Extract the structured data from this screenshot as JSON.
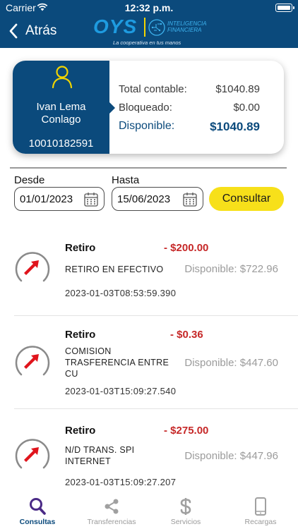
{
  "status_bar": {
    "carrier": "Carrier",
    "time": "12:32 p.m."
  },
  "header": {
    "back_label": "Atrás",
    "logo": {
      "brand": "OYS",
      "line1": "INTELIGENCIA",
      "line2": "FINANCIERA",
      "tagline": "La cooperativa en tus manos"
    }
  },
  "account": {
    "owner": "Ivan Lema Conlago",
    "number": "10010182591",
    "total_label": "Total contable:",
    "total_value": "$1040.89",
    "blocked_label": "Bloqueado:",
    "blocked_value": "$0.00",
    "available_label": "Disponible:",
    "available_value": "$1040.89"
  },
  "filters": {
    "from_label": "Desde",
    "from_value": "01/01/2023",
    "to_label": "Hasta",
    "to_value": "15/06/2023",
    "submit_label": "Consultar"
  },
  "movements": [
    {
      "type": "Retiro",
      "amount": "- $200.00",
      "description": "RETIRO EN EFECTIVO",
      "available": "Disponible: $722.96",
      "date": "2023-01-03T08:53:59.390"
    },
    {
      "type": "Retiro",
      "amount": "- $0.36",
      "description": "COMISION TRASFERENCIA ENTRE CU",
      "available": "Disponible: $447.60",
      "date": "2023-01-03T15:09:27.540"
    },
    {
      "type": "Retiro",
      "amount": "- $275.00",
      "description": "N/D TRANS. SPI INTERNET",
      "available": "Disponible: $447.96",
      "date": "2023-01-03T15:09:27.207"
    }
  ],
  "tabs": [
    {
      "label": "Consultas",
      "icon": "search-icon",
      "active": true
    },
    {
      "label": "Transferencias",
      "icon": "share-icon",
      "active": false
    },
    {
      "label": "Servicios",
      "icon": "dollar-icon",
      "active": false
    },
    {
      "label": "Recargas",
      "icon": "phone-icon",
      "active": false
    }
  ],
  "colors": {
    "primary": "#0b4a7c",
    "accent": "#f7e01a",
    "debit": "#c62828",
    "tab_active": "#4a2a86",
    "logo_blue": "#1e9be0"
  }
}
